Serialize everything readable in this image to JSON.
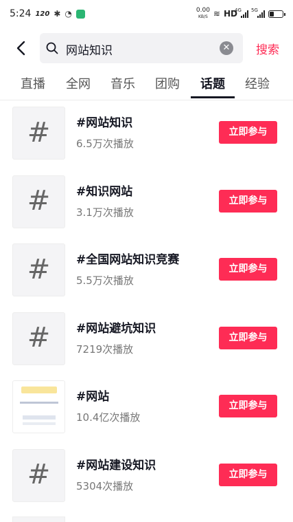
{
  "status_bar": {
    "time": "5:24",
    "speed": "120",
    "net_speed_value": "0.00",
    "net_speed_unit": "KB/S",
    "hd": "HD",
    "sig1": "4G",
    "sig2": "5G"
  },
  "search": {
    "query": "网站知识",
    "submit_label": "搜索"
  },
  "tabs": [
    {
      "label": "直播",
      "active": false
    },
    {
      "label": "全网",
      "active": false
    },
    {
      "label": "音乐",
      "active": false
    },
    {
      "label": "团购",
      "active": false
    },
    {
      "label": "话题",
      "active": true
    },
    {
      "label": "经验",
      "active": false
    }
  ],
  "topics": [
    {
      "title": "#网站知识",
      "plays": "6.5万次播放",
      "button": "立即参与",
      "thumb": "hash-icon"
    },
    {
      "title": "#知识网站",
      "plays": "3.1万次播放",
      "button": "立即参与",
      "thumb": "hash-icon"
    },
    {
      "title": "#全国网站知识竞赛",
      "plays": "5.5万次播放",
      "button": "立即参与",
      "thumb": "hash-icon"
    },
    {
      "title": "#网站避坑知识",
      "plays": "7219次播放",
      "button": "立即参与",
      "thumb": "hash-icon"
    },
    {
      "title": "#网站",
      "plays": "10.4亿次播放",
      "button": "立即参与",
      "thumb": "image"
    },
    {
      "title": "#网站建设知识",
      "plays": "5304次播放",
      "button": "立即参与",
      "thumb": "hash-icon"
    }
  ],
  "colors": {
    "accent": "#fe2c55",
    "text": "#161823"
  }
}
